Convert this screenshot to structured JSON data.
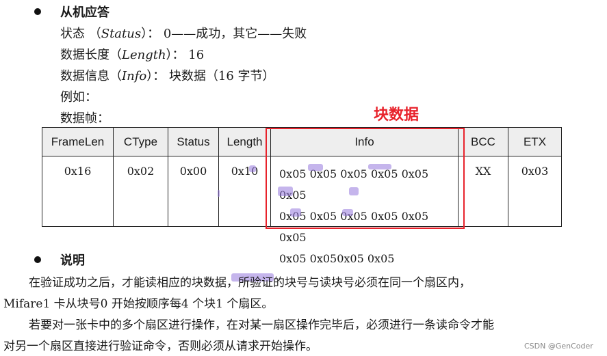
{
  "response": {
    "title": "从机应答",
    "status_line": {
      "pre": "状态 （",
      "key": "Status",
      "post": "）：  0——成功，其它——失败"
    },
    "length_line": {
      "pre": "数据长度（",
      "key": "Length",
      "post": "）：  16"
    },
    "info_line": {
      "pre": "数据信息（",
      "key": "Info",
      "post": "）：  块数据（16  字节）"
    },
    "example_label": "例如：",
    "frame_label": "数据帧：",
    "highlight_title": "块数据"
  },
  "table": {
    "headers": [
      "FrameLen",
      "CType",
      "Status",
      "Length",
      "Info",
      "BCC",
      "ETX"
    ],
    "row": {
      "framelen": "0x16",
      "ctype": "0x02",
      "status": "0x00",
      "length": "0x10",
      "info_lines": [
        "0x05 0x05 0x05 0x05 0x05 0x05",
        "0x05 0x05 0x05 0x05 0x05 0x05",
        "0x05 0x050x05 0x05"
      ],
      "bcc": "XX",
      "etx": "0x03"
    }
  },
  "notes": {
    "title": "说明",
    "p1_line1": "在验证成功之后，才能读相应的块数据，所验证的块号与读块号必须在同一个扇区内，",
    "p1_line2": "Mifare1  卡从块号0  开始按顺序每4  个块1  个扇区。",
    "p2_line1": "若要对一张卡中的多个扇区进行操作，在对某一扇区操作完毕后，必须进行一条读命令才能",
    "p2_line2": "对另一个扇区直接进行验证命令，否则必须从请求开始操作。"
  },
  "watermark": "CSDN @GenCoder",
  "colors": {
    "accent_red": "#e8222b",
    "highlight": "#9678dc",
    "header_bg": "#eeeeee"
  }
}
